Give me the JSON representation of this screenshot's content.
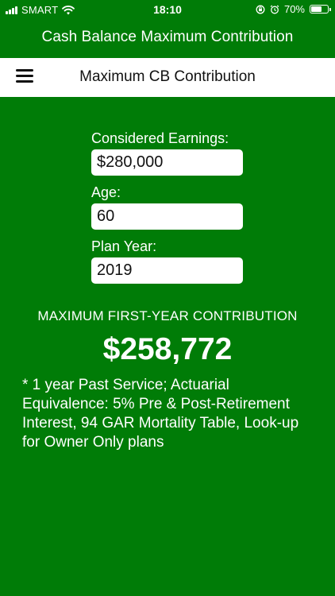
{
  "status_bar": {
    "carrier": "SMART",
    "time": "18:10",
    "battery_percent": "70%",
    "battery_level": 0.7
  },
  "app": {
    "title": "Cash Balance Maximum Contribution"
  },
  "nav": {
    "title": "Maximum CB Contribution",
    "menu_icon": "hamburger-menu-icon"
  },
  "form": {
    "earnings_label": "Considered Earnings:",
    "earnings_value": "$280,000",
    "age_label": "Age:",
    "age_value": "60",
    "plan_year_label": "Plan Year:",
    "plan_year_value": "2019"
  },
  "result": {
    "heading": "MAXIMUM FIRST-YEAR CONTRIBUTION",
    "value": "$258,772",
    "footnote": "* 1 year Past Service; Actuarial Equivalence: 5% Pre & Post-Retirement Interest, 94 GAR Mortality Table, Look-up for Owner Only plans"
  },
  "colors": {
    "background": "#007c07",
    "nav_background": "#ffffff",
    "text": "#ffffff"
  }
}
